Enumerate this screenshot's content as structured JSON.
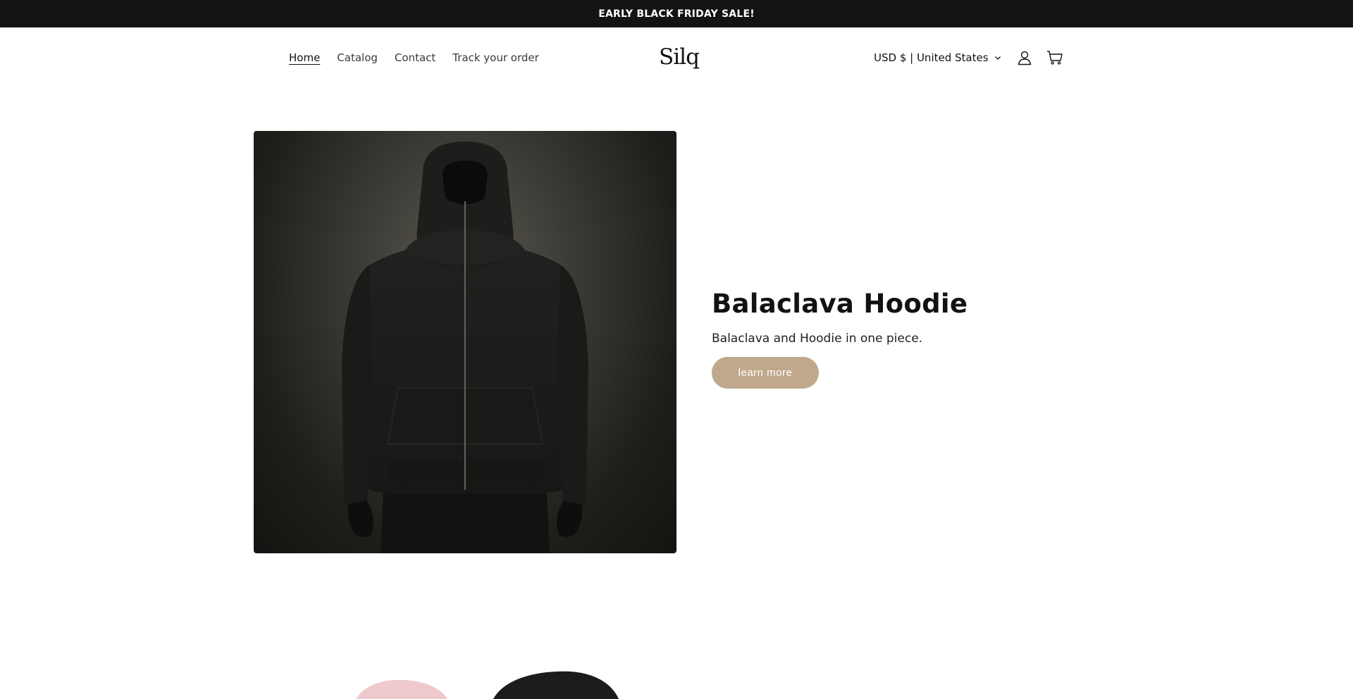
{
  "announcement": {
    "text": "EARLY BLACK FRIDAY SALE!"
  },
  "header": {
    "nav": [
      {
        "label": "Home",
        "active": true
      },
      {
        "label": "Catalog"
      },
      {
        "label": "Contact"
      },
      {
        "label": "Track your order"
      }
    ],
    "logo": "Silq",
    "localization": "USD $ | United States",
    "icons": [
      "account-icon",
      "cart-icon"
    ]
  },
  "hero": {
    "title": "Balaclava Hoodie",
    "subtitle": "Balaclava and Hoodie in one piece.",
    "button_label": "learn more",
    "button_color": "#c0a88c"
  },
  "colors": {
    "announcement_bg": "#131313",
    "text": "#121212"
  }
}
